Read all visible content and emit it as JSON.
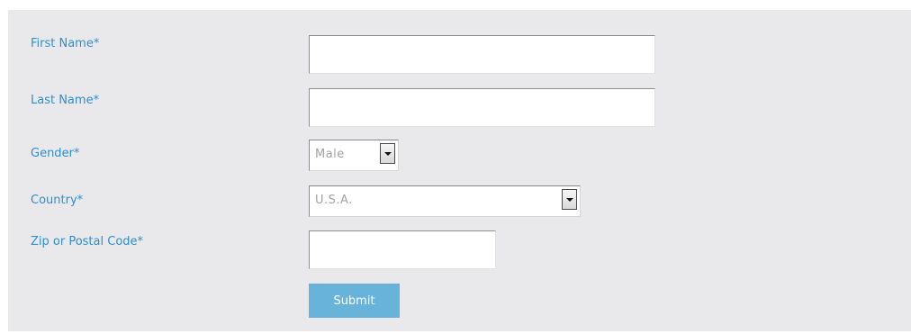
{
  "form": {
    "first_name": {
      "label": "First Name*",
      "value": ""
    },
    "last_name": {
      "label": "Last Name*",
      "value": ""
    },
    "gender": {
      "label": "Gender*",
      "selected": "Male"
    },
    "country": {
      "label": "Country*",
      "selected": "U.S.A."
    },
    "zip": {
      "label": "Zip or Postal Code*",
      "value": ""
    },
    "submit_label": "Submit"
  },
  "colors": {
    "panel_background": "#e9e9ec",
    "label_text": "#2f8ecb",
    "submit_background": "#67b3d9",
    "select_placeholder_text": "#a3a3a3"
  },
  "icons": {
    "select_arrow": "chevron-down-icon"
  }
}
